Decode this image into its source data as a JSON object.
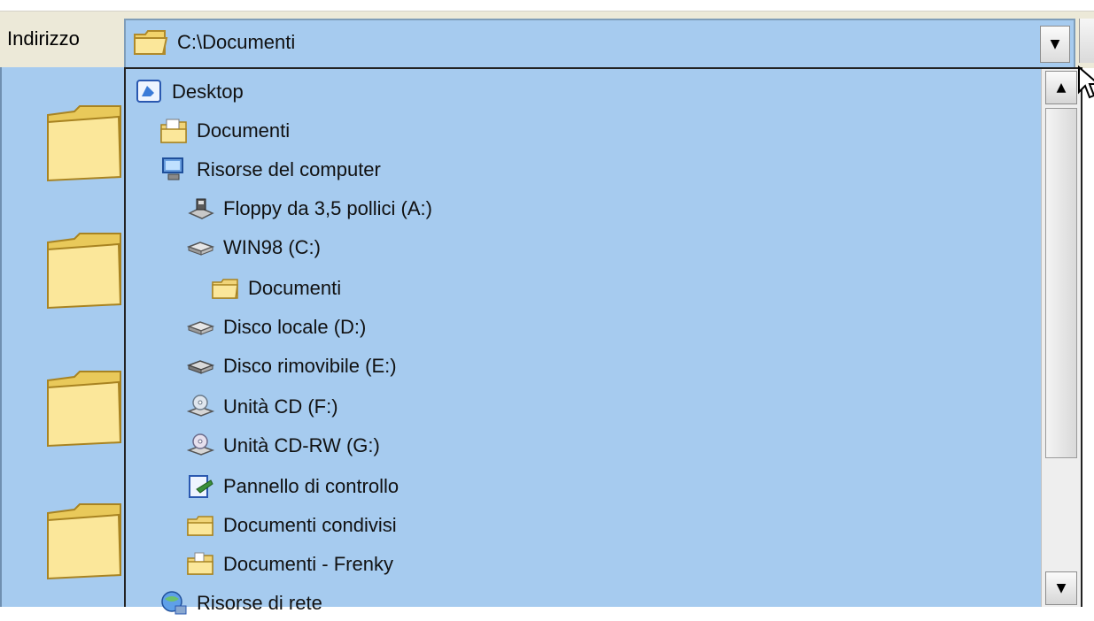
{
  "address_bar": {
    "label": "Indirizzo",
    "value": "C:\\Documenti",
    "icon": "folder-icon"
  },
  "dropdown": {
    "items": [
      {
        "label": "Desktop",
        "icon": "desktop-icon"
      },
      {
        "label": "Documenti",
        "icon": "my-documents-icon"
      },
      {
        "label": "Risorse del computer",
        "icon": "computer-icon"
      },
      {
        "label": "Floppy da 3,5 pollici (A:)",
        "icon": "floppy-drive-icon"
      },
      {
        "label": "WIN98 (C:)",
        "icon": "hard-drive-icon"
      },
      {
        "label": "Documenti",
        "icon": "folder-icon"
      },
      {
        "label": "Disco locale (D:)",
        "icon": "hard-drive-icon"
      },
      {
        "label": "Disco rimovibile (E:)",
        "icon": "removable-disk-icon"
      },
      {
        "label": "Unità CD (F:)",
        "icon": "cd-drive-icon"
      },
      {
        "label": "Unità CD-RW (G:)",
        "icon": "cd-rw-drive-icon"
      },
      {
        "label": "Pannello di controllo",
        "icon": "control-panel-icon"
      },
      {
        "label": "Documenti condivisi",
        "icon": "shared-folder-icon"
      },
      {
        "label": "Documenti - Frenky",
        "icon": "user-folder-icon"
      },
      {
        "label": "Risorse di rete",
        "icon": "network-icon"
      }
    ]
  },
  "colors": {
    "list_background": "#a6cbef",
    "caption": "#8b0f12"
  }
}
